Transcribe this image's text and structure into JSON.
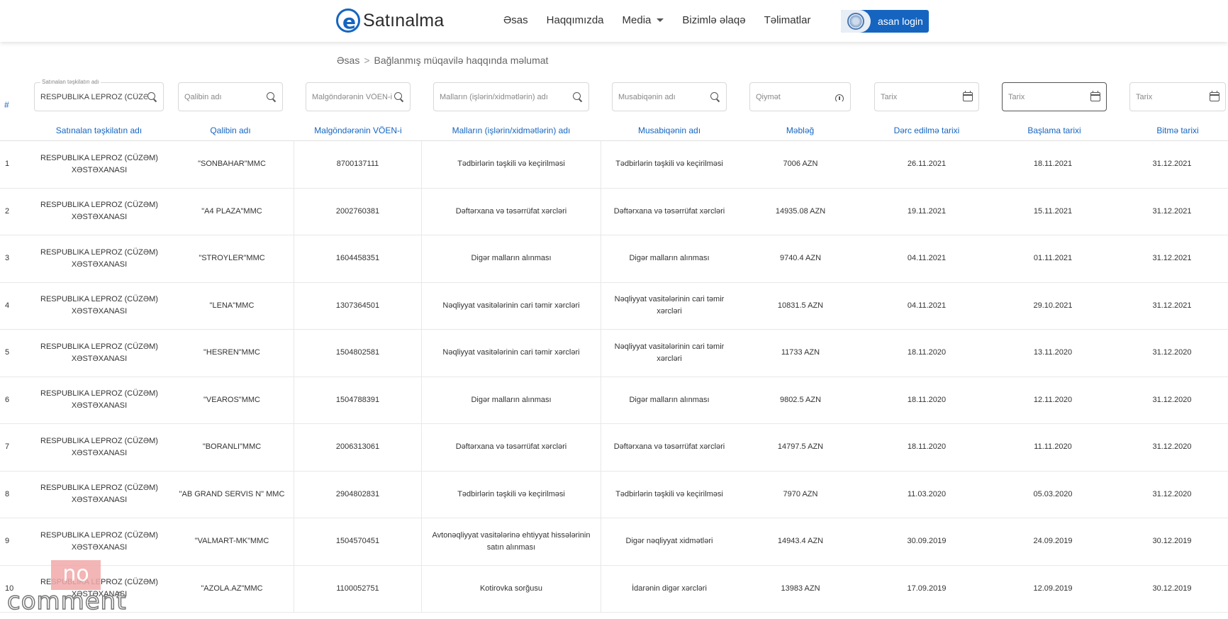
{
  "header": {
    "logo_text": "Satınalma",
    "logo_letter": "e",
    "nav": [
      {
        "label": "Əsas"
      },
      {
        "label": "Haqqımızda"
      },
      {
        "label": "Media"
      },
      {
        "label": "Bizimlə əlaqə"
      },
      {
        "label": "Təlimatlar"
      }
    ],
    "login_label": "asan login"
  },
  "breadcrumb": {
    "home": "Əsas",
    "separator": ">",
    "current": "Bağlanmış müqavilə haqqında məlumat"
  },
  "filters": {
    "org": {
      "floating_label": "Satınalan təşkilatın adı",
      "value": "RESPUBLIKA LEPROZ (CÜZƏM)"
    },
    "template": {
      "placeholder": "Qalibin adı"
    },
    "voen": {
      "placeholder": "Malgöndərənin VÖEN-i"
    },
    "goods": {
      "placeholder": "Malların (işlərin/xidmətlərin) adı"
    },
    "competition": {
      "placeholder": "Musabiqənin adı"
    },
    "price": {
      "placeholder": "Qiymət"
    },
    "date1": {
      "placeholder": "Tarix"
    },
    "date2": {
      "placeholder": "Tarix"
    },
    "date3": {
      "placeholder": "Tarix"
    }
  },
  "table": {
    "hash": "#",
    "headers": [
      "Satınalan təşkilatın adı",
      "Qalibin adı",
      "Malgöndərənin VÖEN-i",
      "Malların (işlərin/xidmətlərin) adı",
      "Musabiqənin adı",
      "Məbləğ",
      "Dərc edilmə tarixi",
      "Başlama tarixi",
      "Bitmə tarixi"
    ],
    "rows": [
      {
        "n": "1",
        "org": "RESPUBLIKA LEPROZ (CÜZƏM) XƏSTƏXANASI",
        "winner": "\"SONBAHAR\"MMC",
        "voen": "8700137111",
        "goods": "Tədbirlərin təşkili və keçirilməsi",
        "competition": "Tədbirlərin təşkili və keçirilməsi",
        "amount": "7006 AZN",
        "published": "26.11.2021",
        "start": "18.11.2021",
        "end": "31.12.2021"
      },
      {
        "n": "2",
        "org": "RESPUBLIKA LEPROZ (CÜZƏM) XƏSTƏXANASI",
        "winner": "\"A4 PLAZA\"MMC",
        "voen": "2002760381",
        "goods": "Dəftərxana və təsərrüfat xərcləri",
        "competition": "Dəftərxana və təsərrüfat xərcləri",
        "amount": "14935.08 AZN",
        "published": "19.11.2021",
        "start": "15.11.2021",
        "end": "31.12.2021"
      },
      {
        "n": "3",
        "org": "RESPUBLIKA LEPROZ (CÜZƏM) XƏSTƏXANASI",
        "winner": "\"STROYLER\"MMC",
        "voen": "1604458351",
        "goods": "Digər malların alınması",
        "competition": "Digər malların alınması",
        "amount": "9740.4 AZN",
        "published": "04.11.2021",
        "start": "01.11.2021",
        "end": "31.12.2021"
      },
      {
        "n": "4",
        "org": "RESPUBLIKA LEPROZ (CÜZƏM) XƏSTƏXANASI",
        "winner": "\"LENA\"MMC",
        "voen": "1307364501",
        "goods": "Nəqliyyat vasitələrinin cari təmir xərcləri",
        "competition": "Nəqliyyat vasitələrinin cari təmir xərcləri",
        "amount": "10831.5 AZN",
        "published": "04.11.2021",
        "start": "29.10.2021",
        "end": "31.12.2021"
      },
      {
        "n": "5",
        "org": "RESPUBLIKA LEPROZ (CÜZƏM) XƏSTƏXANASI",
        "winner": "\"HESREN\"MMC",
        "voen": "1504802581",
        "goods": "Nəqliyyat vasitələrinin cari təmir xərcləri",
        "competition": "Nəqliyyat vasitələrinin cari təmir xərcləri",
        "amount": "11733 AZN",
        "published": "18.11.2020",
        "start": "13.11.2020",
        "end": "31.12.2020"
      },
      {
        "n": "6",
        "org": "RESPUBLIKA LEPROZ (CÜZƏM) XƏSTƏXANASI",
        "winner": "\"VEAROS\"MMC",
        "voen": "1504788391",
        "goods": "Digər malların alınması",
        "competition": "Digər malların alınması",
        "amount": "9802.5 AZN",
        "published": "18.11.2020",
        "start": "12.11.2020",
        "end": "31.12.2020"
      },
      {
        "n": "7",
        "org": "RESPUBLIKA LEPROZ (CÜZƏM) XƏSTƏXANASI",
        "winner": "\"BORANLI\"MMC",
        "voen": "2006313061",
        "goods": "Dəftərxana və təsərrüfat xərcləri",
        "competition": "Dəftərxana və təsərrüfat xərcləri",
        "amount": "14797.5 AZN",
        "published": "18.11.2020",
        "start": "11.11.2020",
        "end": "31.12.2020"
      },
      {
        "n": "8",
        "org": "RESPUBLIKA LEPROZ (CÜZƏM) XƏSTƏXANASI",
        "winner": "\"AB GRAND SERVIS N\" MMC",
        "voen": "2904802831",
        "goods": "Tədbirlərin təşkili və keçirilməsi",
        "competition": "Tədbirlərin təşkili və keçirilməsi",
        "amount": "7970 AZN",
        "published": "11.03.2020",
        "start": "05.03.2020",
        "end": "31.12.2020"
      },
      {
        "n": "9",
        "org": "RESPUBLIKA LEPROZ (CÜZƏM) XƏSTƏXANASI",
        "winner": "\"VALMART-MK\"MMC",
        "voen": "1504570451",
        "goods": "Avtonəqliyyat vasitələrinə ehtiyyat hissələrinin satın alınması",
        "competition": "Digər nəqliyyat xidmətləri",
        "amount": "14943.4 AZN",
        "published": "30.09.2019",
        "start": "24.09.2019",
        "end": "30.12.2019"
      },
      {
        "n": "10",
        "org": "RESPUBLIKA LEPROZ (CÜZƏM) XƏSTƏXANASI",
        "winner": "\"AZOLA.AZ\"MMC",
        "voen": "1100052751",
        "goods": "Kotirovka sorğusu",
        "competition": "İdarənin digər xərcləri",
        "amount": "13983 AZN",
        "published": "17.09.2019",
        "start": "12.09.2019",
        "end": "30.12.2019"
      }
    ]
  },
  "watermark": {
    "top": "no",
    "bottom": "comment"
  },
  "colors": {
    "accent": "#1565c0",
    "border": "#e8e8e8"
  }
}
